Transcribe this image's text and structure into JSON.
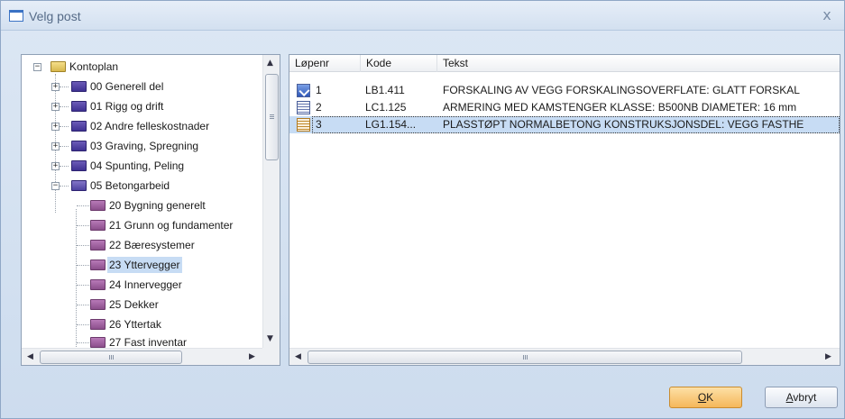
{
  "window": {
    "title": "Velg post",
    "close_glyph": "x"
  },
  "tree": {
    "root": "Kontoplan",
    "items": [
      {
        "label": "00 Generell del"
      },
      {
        "label": "01 Rigg og drift"
      },
      {
        "label": "02 Andre felleskostnader"
      },
      {
        "label": "03 Graving, Spregning"
      },
      {
        "label": "04 Spunting, Peling"
      },
      {
        "label": "05 Betongarbeid"
      }
    ],
    "children": [
      {
        "label": "20 Bygning generelt"
      },
      {
        "label": "21 Grunn og fundamenter"
      },
      {
        "label": "22 Bæresystemer"
      },
      {
        "label": "23 Yttervegger"
      },
      {
        "label": "24 Innervegger"
      },
      {
        "label": "25 Dekker"
      },
      {
        "label": "26 Yttertak"
      },
      {
        "label": "27 Fast inventar"
      }
    ],
    "selected": "23 Yttervegger"
  },
  "list": {
    "columns": {
      "lopenr": "Løpenr",
      "kode": "Kode",
      "tekst": "Tekst"
    },
    "rows": [
      {
        "nr": "1",
        "kode": "LB1.411",
        "tekst": "FORSKALING AV VEGG  FORSKALINGSOVERFLATE: GLATT  FORSKAL",
        "icon": "checked-post-icon"
      },
      {
        "nr": "2",
        "kode": "LC1.125",
        "tekst": "ARMERING MED KAMSTENGER  KLASSE: B500NB  DIAMETER: 16 mm",
        "icon": "post-icon"
      },
      {
        "nr": "3",
        "kode": "LG1.154...",
        "tekst": "PLASSTØPT NORMALBETONG  KONSTRUKSJONSDEL: VEGG  FASTHE",
        "icon": "post-icon-selected"
      }
    ]
  },
  "buttons": {
    "ok_key": "O",
    "ok_rest": "K",
    "cancel_key": "A",
    "cancel_rest": "vbryt"
  },
  "scroll": {
    "grip_glyph": "III"
  },
  "colors": {
    "selection": "#c7dcf4",
    "ok_button": "#f5b75a",
    "folder": "#4e42a0"
  }
}
